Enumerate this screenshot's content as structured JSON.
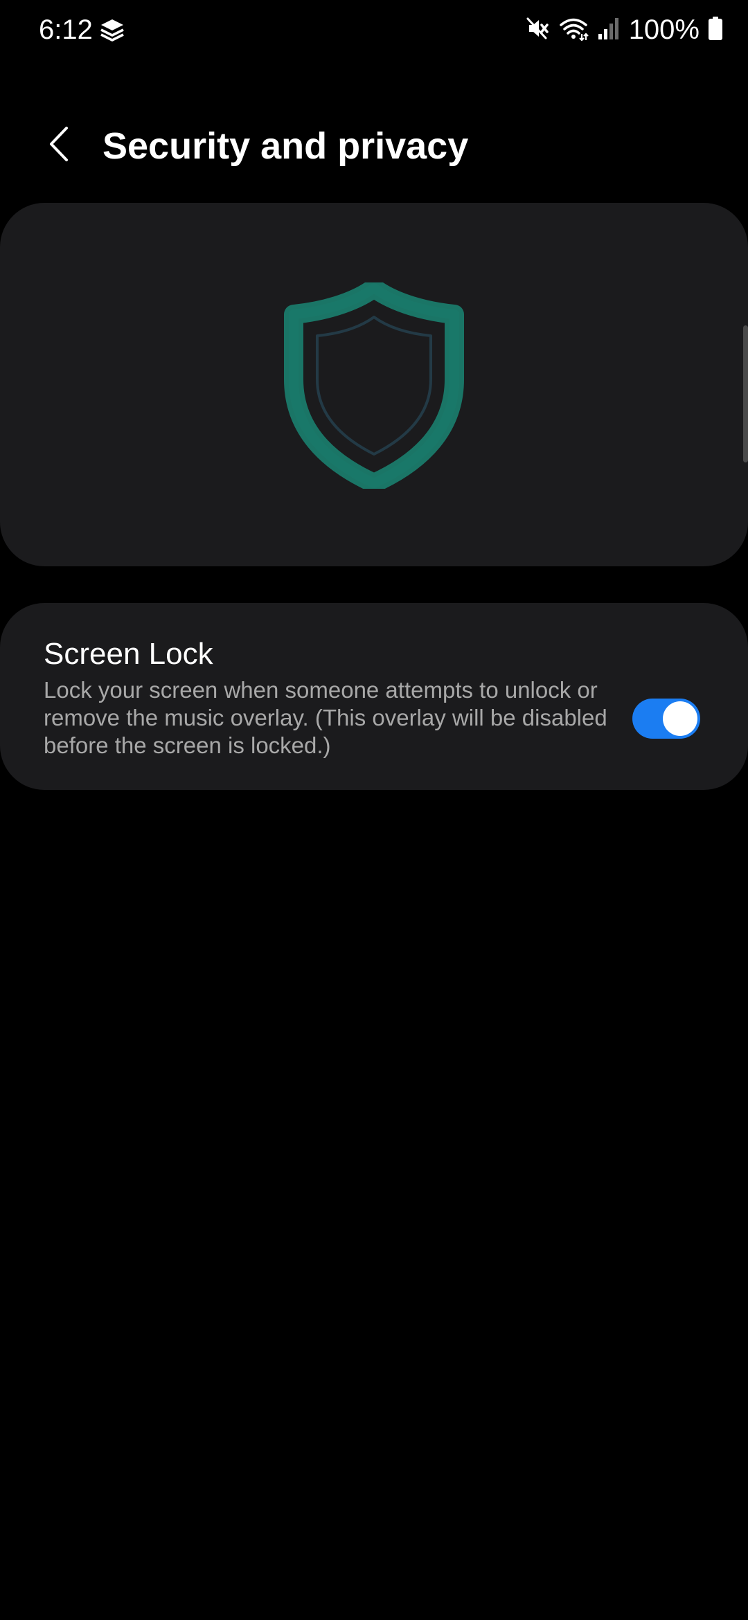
{
  "status_bar": {
    "time": "6:12",
    "battery_percent": "100%",
    "icons": [
      "layers-icon",
      "mute-icon",
      "wifi-icon",
      "signal-icon",
      "battery-icon"
    ]
  },
  "header": {
    "title": "Security and privacy",
    "back_icon": "chevron-left-icon"
  },
  "hero": {
    "icon": "shield-icon",
    "icon_color": "#1a7a6a"
  },
  "settings": {
    "screen_lock": {
      "title": "Screen Lock",
      "description": "Lock your screen when someone attempts to unlock or remove the music overlay. (This overlay will be disabled before the screen is locked.)",
      "enabled": true
    }
  },
  "colors": {
    "background": "#000000",
    "card": "#1b1b1d",
    "accent": "#1b7df2",
    "secondary_text": "#a8a8a8"
  }
}
